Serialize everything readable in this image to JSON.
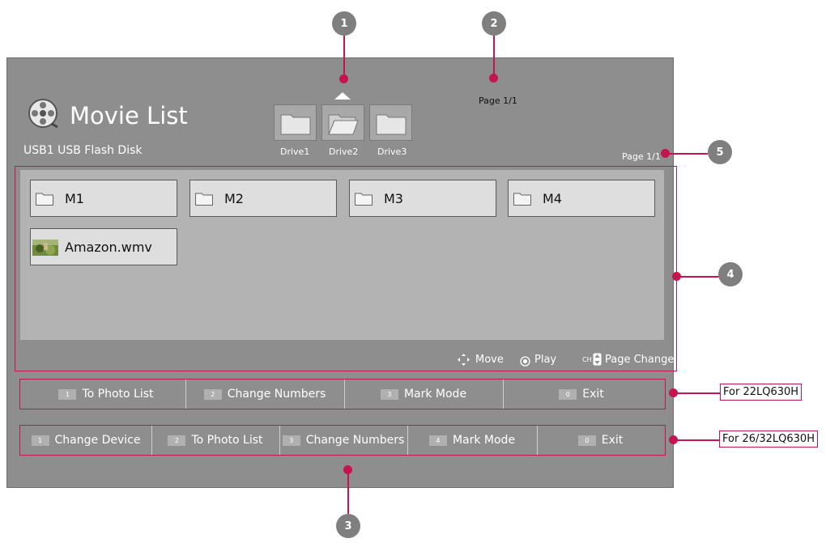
{
  "header": {
    "title": "Movie List",
    "disk_label": "USB1 USB Flash Disk",
    "top_page_indicator": "Page 1/1",
    "list_page_indicator": "Page 1/1"
  },
  "drives": [
    {
      "label": "Drive1",
      "selected": false
    },
    {
      "label": "Drive2",
      "selected": true
    },
    {
      "label": "Drive3",
      "selected": false
    }
  ],
  "items": [
    {
      "label": "M1",
      "type": "folder"
    },
    {
      "label": "M2",
      "type": "folder"
    },
    {
      "label": "M3",
      "type": "folder"
    },
    {
      "label": "M4",
      "type": "folder"
    },
    {
      "label": "Amazon.wmv",
      "type": "video"
    }
  ],
  "hints": {
    "move": "Move",
    "play": "Play",
    "ch": "CH",
    "page_change": "Page Change"
  },
  "bar1": {
    "buttons": [
      {
        "key": "1",
        "label": "To Photo List"
      },
      {
        "key": "2",
        "label": "Change Numbers"
      },
      {
        "key": "3",
        "label": "Mark Mode"
      },
      {
        "key": "0",
        "label": "Exit"
      }
    ],
    "tag": "For 22LQ630H"
  },
  "bar2": {
    "buttons": [
      {
        "key": "1",
        "label": "Change Device"
      },
      {
        "key": "2",
        "label": "To Photo List"
      },
      {
        "key": "3",
        "label": "Change Numbers"
      },
      {
        "key": "4",
        "label": "Mark Mode"
      },
      {
        "key": "0",
        "label": "Exit"
      }
    ],
    "tag": "For 26/32LQ630H"
  },
  "callouts": [
    "1",
    "2",
    "3",
    "4",
    "5"
  ],
  "colors": {
    "accent": "#c4154f",
    "panel": "#8e8e8e",
    "list_background": "#b3b3b3",
    "item_background": "#dedede",
    "callout": "#7f7f7f"
  }
}
